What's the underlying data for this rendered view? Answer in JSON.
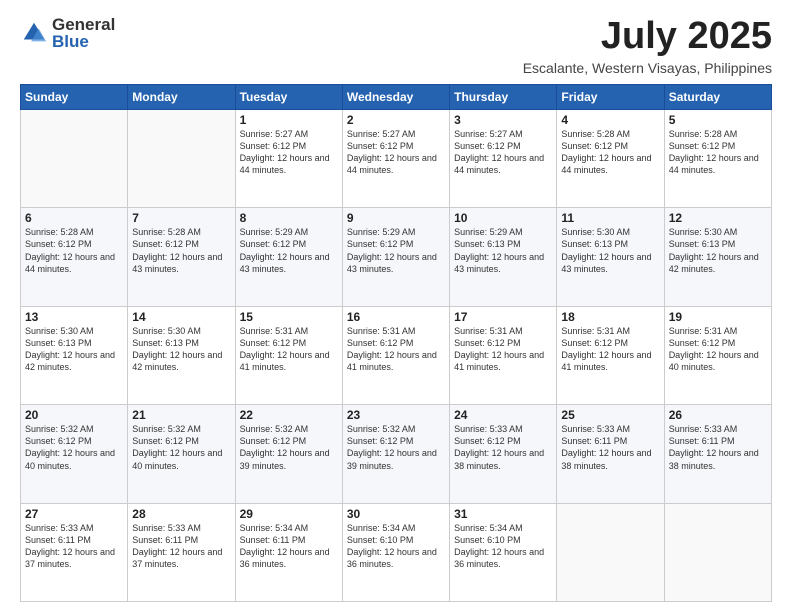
{
  "logo": {
    "general": "General",
    "blue": "Blue"
  },
  "title": "July 2025",
  "location": "Escalante, Western Visayas, Philippines",
  "days_of_week": [
    "Sunday",
    "Monday",
    "Tuesday",
    "Wednesday",
    "Thursday",
    "Friday",
    "Saturday"
  ],
  "weeks": [
    [
      {
        "day": "",
        "info": ""
      },
      {
        "day": "",
        "info": ""
      },
      {
        "day": "1",
        "info": "Sunrise: 5:27 AM\nSunset: 6:12 PM\nDaylight: 12 hours and 44 minutes."
      },
      {
        "day": "2",
        "info": "Sunrise: 5:27 AM\nSunset: 6:12 PM\nDaylight: 12 hours and 44 minutes."
      },
      {
        "day": "3",
        "info": "Sunrise: 5:27 AM\nSunset: 6:12 PM\nDaylight: 12 hours and 44 minutes."
      },
      {
        "day": "4",
        "info": "Sunrise: 5:28 AM\nSunset: 6:12 PM\nDaylight: 12 hours and 44 minutes."
      },
      {
        "day": "5",
        "info": "Sunrise: 5:28 AM\nSunset: 6:12 PM\nDaylight: 12 hours and 44 minutes."
      }
    ],
    [
      {
        "day": "6",
        "info": "Sunrise: 5:28 AM\nSunset: 6:12 PM\nDaylight: 12 hours and 44 minutes."
      },
      {
        "day": "7",
        "info": "Sunrise: 5:28 AM\nSunset: 6:12 PM\nDaylight: 12 hours and 43 minutes."
      },
      {
        "day": "8",
        "info": "Sunrise: 5:29 AM\nSunset: 6:12 PM\nDaylight: 12 hours and 43 minutes."
      },
      {
        "day": "9",
        "info": "Sunrise: 5:29 AM\nSunset: 6:12 PM\nDaylight: 12 hours and 43 minutes."
      },
      {
        "day": "10",
        "info": "Sunrise: 5:29 AM\nSunset: 6:13 PM\nDaylight: 12 hours and 43 minutes."
      },
      {
        "day": "11",
        "info": "Sunrise: 5:30 AM\nSunset: 6:13 PM\nDaylight: 12 hours and 43 minutes."
      },
      {
        "day": "12",
        "info": "Sunrise: 5:30 AM\nSunset: 6:13 PM\nDaylight: 12 hours and 42 minutes."
      }
    ],
    [
      {
        "day": "13",
        "info": "Sunrise: 5:30 AM\nSunset: 6:13 PM\nDaylight: 12 hours and 42 minutes."
      },
      {
        "day": "14",
        "info": "Sunrise: 5:30 AM\nSunset: 6:13 PM\nDaylight: 12 hours and 42 minutes."
      },
      {
        "day": "15",
        "info": "Sunrise: 5:31 AM\nSunset: 6:12 PM\nDaylight: 12 hours and 41 minutes."
      },
      {
        "day": "16",
        "info": "Sunrise: 5:31 AM\nSunset: 6:12 PM\nDaylight: 12 hours and 41 minutes."
      },
      {
        "day": "17",
        "info": "Sunrise: 5:31 AM\nSunset: 6:12 PM\nDaylight: 12 hours and 41 minutes."
      },
      {
        "day": "18",
        "info": "Sunrise: 5:31 AM\nSunset: 6:12 PM\nDaylight: 12 hours and 41 minutes."
      },
      {
        "day": "19",
        "info": "Sunrise: 5:31 AM\nSunset: 6:12 PM\nDaylight: 12 hours and 40 minutes."
      }
    ],
    [
      {
        "day": "20",
        "info": "Sunrise: 5:32 AM\nSunset: 6:12 PM\nDaylight: 12 hours and 40 minutes."
      },
      {
        "day": "21",
        "info": "Sunrise: 5:32 AM\nSunset: 6:12 PM\nDaylight: 12 hours and 40 minutes."
      },
      {
        "day": "22",
        "info": "Sunrise: 5:32 AM\nSunset: 6:12 PM\nDaylight: 12 hours and 39 minutes."
      },
      {
        "day": "23",
        "info": "Sunrise: 5:32 AM\nSunset: 6:12 PM\nDaylight: 12 hours and 39 minutes."
      },
      {
        "day": "24",
        "info": "Sunrise: 5:33 AM\nSunset: 6:12 PM\nDaylight: 12 hours and 38 minutes."
      },
      {
        "day": "25",
        "info": "Sunrise: 5:33 AM\nSunset: 6:11 PM\nDaylight: 12 hours and 38 minutes."
      },
      {
        "day": "26",
        "info": "Sunrise: 5:33 AM\nSunset: 6:11 PM\nDaylight: 12 hours and 38 minutes."
      }
    ],
    [
      {
        "day": "27",
        "info": "Sunrise: 5:33 AM\nSunset: 6:11 PM\nDaylight: 12 hours and 37 minutes."
      },
      {
        "day": "28",
        "info": "Sunrise: 5:33 AM\nSunset: 6:11 PM\nDaylight: 12 hours and 37 minutes."
      },
      {
        "day": "29",
        "info": "Sunrise: 5:34 AM\nSunset: 6:11 PM\nDaylight: 12 hours and 36 minutes."
      },
      {
        "day": "30",
        "info": "Sunrise: 5:34 AM\nSunset: 6:10 PM\nDaylight: 12 hours and 36 minutes."
      },
      {
        "day": "31",
        "info": "Sunrise: 5:34 AM\nSunset: 6:10 PM\nDaylight: 12 hours and 36 minutes."
      },
      {
        "day": "",
        "info": ""
      },
      {
        "day": "",
        "info": ""
      }
    ]
  ]
}
